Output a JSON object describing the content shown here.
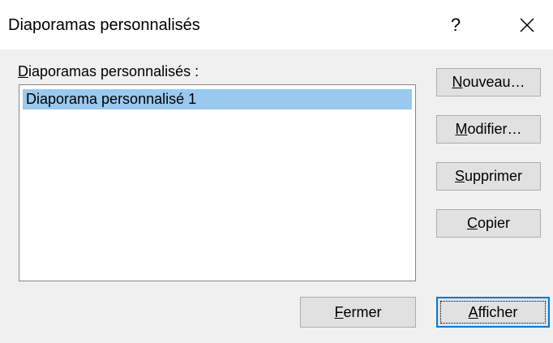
{
  "window": {
    "title": "Diaporamas personnalisés",
    "help_glyph": "?",
    "close_glyph": "✕"
  },
  "list": {
    "label": "Diaporamas personnalisés :",
    "label_access_key": "D",
    "items": [
      {
        "label": "Diaporama personnalisé 1",
        "selected": true
      }
    ],
    "selection_color": "#99c9ef"
  },
  "buttons": {
    "new": {
      "label": "Nouveau…",
      "access_key": "N"
    },
    "edit": {
      "label": "Modifier…",
      "access_key": "M"
    },
    "delete": {
      "label": "Supprimer",
      "access_key": "S"
    },
    "copy": {
      "label": "Copier",
      "access_key": "C"
    },
    "close": {
      "label": "Fermer",
      "access_key": "F"
    },
    "show": {
      "label": "Afficher",
      "access_key": "A"
    }
  },
  "colors": {
    "accent": "#0078d7",
    "button_face": "#e1e1e1",
    "dialog_bg": "#f0f0f0"
  }
}
